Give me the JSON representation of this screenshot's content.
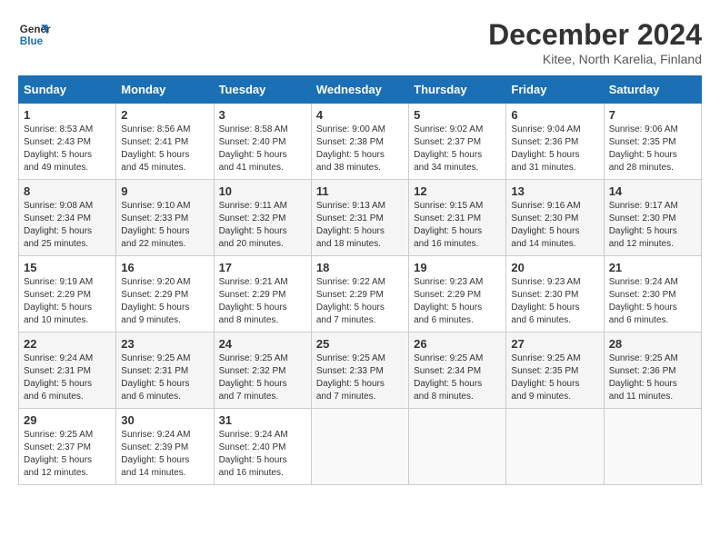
{
  "logo": {
    "line1": "General",
    "line2": "Blue"
  },
  "title": "December 2024",
  "location": "Kitee, North Karelia, Finland",
  "days_of_week": [
    "Sunday",
    "Monday",
    "Tuesday",
    "Wednesday",
    "Thursday",
    "Friday",
    "Saturday"
  ],
  "weeks": [
    [
      {
        "day": "1",
        "info": "Sunrise: 8:53 AM\nSunset: 2:43 PM\nDaylight: 5 hours\nand 49 minutes."
      },
      {
        "day": "2",
        "info": "Sunrise: 8:56 AM\nSunset: 2:41 PM\nDaylight: 5 hours\nand 45 minutes."
      },
      {
        "day": "3",
        "info": "Sunrise: 8:58 AM\nSunset: 2:40 PM\nDaylight: 5 hours\nand 41 minutes."
      },
      {
        "day": "4",
        "info": "Sunrise: 9:00 AM\nSunset: 2:38 PM\nDaylight: 5 hours\nand 38 minutes."
      },
      {
        "day": "5",
        "info": "Sunrise: 9:02 AM\nSunset: 2:37 PM\nDaylight: 5 hours\nand 34 minutes."
      },
      {
        "day": "6",
        "info": "Sunrise: 9:04 AM\nSunset: 2:36 PM\nDaylight: 5 hours\nand 31 minutes."
      },
      {
        "day": "7",
        "info": "Sunrise: 9:06 AM\nSunset: 2:35 PM\nDaylight: 5 hours\nand 28 minutes."
      }
    ],
    [
      {
        "day": "8",
        "info": "Sunrise: 9:08 AM\nSunset: 2:34 PM\nDaylight: 5 hours\nand 25 minutes."
      },
      {
        "day": "9",
        "info": "Sunrise: 9:10 AM\nSunset: 2:33 PM\nDaylight: 5 hours\nand 22 minutes."
      },
      {
        "day": "10",
        "info": "Sunrise: 9:11 AM\nSunset: 2:32 PM\nDaylight: 5 hours\nand 20 minutes."
      },
      {
        "day": "11",
        "info": "Sunrise: 9:13 AM\nSunset: 2:31 PM\nDaylight: 5 hours\nand 18 minutes."
      },
      {
        "day": "12",
        "info": "Sunrise: 9:15 AM\nSunset: 2:31 PM\nDaylight: 5 hours\nand 16 minutes."
      },
      {
        "day": "13",
        "info": "Sunrise: 9:16 AM\nSunset: 2:30 PM\nDaylight: 5 hours\nand 14 minutes."
      },
      {
        "day": "14",
        "info": "Sunrise: 9:17 AM\nSunset: 2:30 PM\nDaylight: 5 hours\nand 12 minutes."
      }
    ],
    [
      {
        "day": "15",
        "info": "Sunrise: 9:19 AM\nSunset: 2:29 PM\nDaylight: 5 hours\nand 10 minutes."
      },
      {
        "day": "16",
        "info": "Sunrise: 9:20 AM\nSunset: 2:29 PM\nDaylight: 5 hours\nand 9 minutes."
      },
      {
        "day": "17",
        "info": "Sunrise: 9:21 AM\nSunset: 2:29 PM\nDaylight: 5 hours\nand 8 minutes."
      },
      {
        "day": "18",
        "info": "Sunrise: 9:22 AM\nSunset: 2:29 PM\nDaylight: 5 hours\nand 7 minutes."
      },
      {
        "day": "19",
        "info": "Sunrise: 9:23 AM\nSunset: 2:29 PM\nDaylight: 5 hours\nand 6 minutes."
      },
      {
        "day": "20",
        "info": "Sunrise: 9:23 AM\nSunset: 2:30 PM\nDaylight: 5 hours\nand 6 minutes."
      },
      {
        "day": "21",
        "info": "Sunrise: 9:24 AM\nSunset: 2:30 PM\nDaylight: 5 hours\nand 6 minutes."
      }
    ],
    [
      {
        "day": "22",
        "info": "Sunrise: 9:24 AM\nSunset: 2:31 PM\nDaylight: 5 hours\nand 6 minutes."
      },
      {
        "day": "23",
        "info": "Sunrise: 9:25 AM\nSunset: 2:31 PM\nDaylight: 5 hours\nand 6 minutes."
      },
      {
        "day": "24",
        "info": "Sunrise: 9:25 AM\nSunset: 2:32 PM\nDaylight: 5 hours\nand 7 minutes."
      },
      {
        "day": "25",
        "info": "Sunrise: 9:25 AM\nSunset: 2:33 PM\nDaylight: 5 hours\nand 7 minutes."
      },
      {
        "day": "26",
        "info": "Sunrise: 9:25 AM\nSunset: 2:34 PM\nDaylight: 5 hours\nand 8 minutes."
      },
      {
        "day": "27",
        "info": "Sunrise: 9:25 AM\nSunset: 2:35 PM\nDaylight: 5 hours\nand 9 minutes."
      },
      {
        "day": "28",
        "info": "Sunrise: 9:25 AM\nSunset: 2:36 PM\nDaylight: 5 hours\nand 11 minutes."
      }
    ],
    [
      {
        "day": "29",
        "info": "Sunrise: 9:25 AM\nSunset: 2:37 PM\nDaylight: 5 hours\nand 12 minutes."
      },
      {
        "day": "30",
        "info": "Sunrise: 9:24 AM\nSunset: 2:39 PM\nDaylight: 5 hours\nand 14 minutes."
      },
      {
        "day": "31",
        "info": "Sunrise: 9:24 AM\nSunset: 2:40 PM\nDaylight: 5 hours\nand 16 minutes."
      },
      {
        "day": "",
        "info": ""
      },
      {
        "day": "",
        "info": ""
      },
      {
        "day": "",
        "info": ""
      },
      {
        "day": "",
        "info": ""
      }
    ]
  ]
}
